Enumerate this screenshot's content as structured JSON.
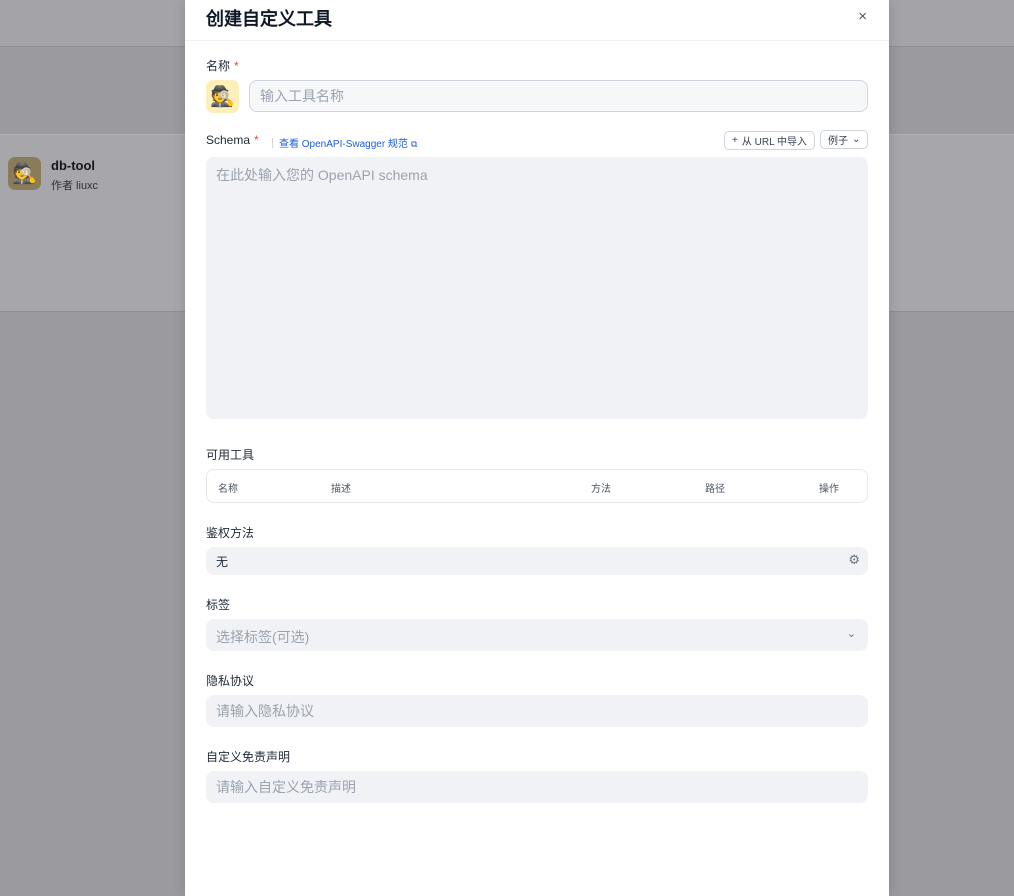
{
  "background": {
    "tool_card": {
      "avatar_emoji": "🕵️",
      "name": "db-tool",
      "author": "作者 liuxc"
    }
  },
  "modal": {
    "title": "创建自定义工具",
    "close_icon": "×",
    "name_field": {
      "label": "名称",
      "required_mark": "*",
      "avatar_emoji": "🕵️",
      "placeholder": "输入工具名称",
      "value": ""
    },
    "schema": {
      "label": "Schema",
      "required_mark": "*",
      "spec_link": "查看 OpenAPI-Swagger 规范",
      "link_icon": "external-link-icon",
      "import_button": "从 URL 中导入",
      "import_icon": "+",
      "example_button": "例子",
      "placeholder": "在此处输入您的 OpenAPI schema",
      "value": ""
    },
    "available_tools": {
      "label": "可用工具",
      "columns": [
        "名称",
        "描述",
        "方法",
        "路径",
        "操作"
      ],
      "rows": []
    },
    "auth": {
      "label": "鉴权方法",
      "value": "无",
      "icon": "gear-icon"
    },
    "tags": {
      "label": "标签",
      "placeholder": "选择标签(可选)",
      "icon": "chevron-down-icon"
    },
    "privacy": {
      "label": "隐私协议",
      "placeholder": "请输入隐私协议"
    },
    "disclaimer": {
      "label": "自定义免责声明",
      "placeholder": "请输入自定义免责声明"
    }
  }
}
